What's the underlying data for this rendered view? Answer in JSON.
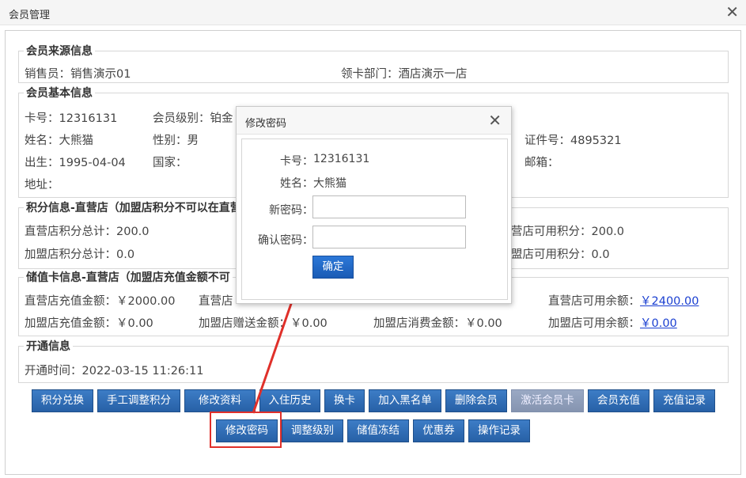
{
  "window": {
    "title": "会员管理",
    "close": "✕"
  },
  "source": {
    "legend": "会员来源信息",
    "salesperson": "销售员：销售演示01",
    "dept": "领卡部门：酒店演示一店"
  },
  "basic": {
    "legend": "会员基本信息",
    "card_no": "卡号：12316131",
    "level": "会员级别：铂金",
    "id_no": "证件号：4895321",
    "name": "姓名：大熊猫",
    "gender": "性别：男",
    "birth": "出生：1995-04-04",
    "country": "国家：",
    "email": "邮箱：",
    "address": "地址："
  },
  "points": {
    "legend": "积分信息-直营店（加盟店积分不可以在直营",
    "direct_total": "直营店积分总计：200.0",
    "direct_avail": "营店可用积分：200.0",
    "franchise_total": "加盟店积分总计：0.0",
    "franchise_avail": "盟店可用积分：0.0"
  },
  "stored": {
    "legend": "储值卡信息-直营店（加盟店充值金额不可",
    "direct_recharge": "直营店充值金额：￥2000.00",
    "direct_gift": "直营店",
    "direct_avail_label": "直营店可用余额：",
    "direct_avail_value": "￥2400.00",
    "franchise_recharge": "加盟店充值金额：￥0.00",
    "franchise_gift": "加盟店赠送金额：￥0.00",
    "franchise_spent": "加盟店消费金额：￥0.00",
    "franchise_avail_label": "加盟店可用余额：",
    "franchise_avail_value": "￥0.00"
  },
  "open": {
    "legend": "开通信息",
    "time": "开通时间：2022-03-15 11:26:11"
  },
  "buttons_row1": [
    "积分兑换",
    "手工调整积分",
    "修改资料",
    "入住历史",
    "换卡",
    "加入黑名单",
    "删除会员",
    "激活会员卡",
    "会员充值",
    "充值记录"
  ],
  "buttons_row2": [
    "修改密码",
    "调整级别",
    "储值冻结",
    "优惠券",
    "操作记录"
  ],
  "modal": {
    "title": "修改密码",
    "close": "✕",
    "card_label": "卡号：",
    "card_value": "12316131",
    "name_label": "姓名：",
    "name_value": "大熊猫",
    "new_pwd_label": "新密码：",
    "confirm_pwd_label": "确认密码：",
    "new_pwd_value": "",
    "confirm_pwd_value": "",
    "ok": "确定"
  },
  "colors": {
    "button": "#2d6cb8",
    "disabled_button": "#8d9bb7",
    "link": "#1a3fd1",
    "highlight": "#e0302a"
  }
}
